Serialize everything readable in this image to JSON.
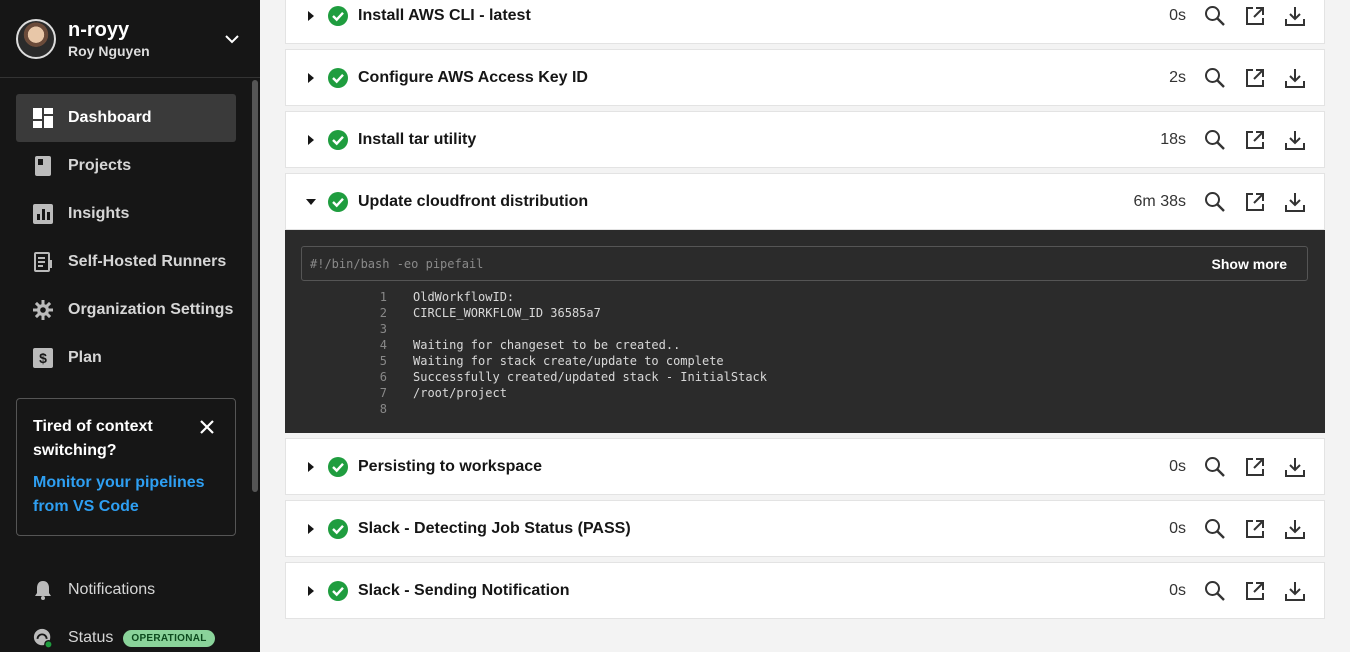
{
  "user": {
    "handle": "n-royy",
    "name": "Roy Nguyen"
  },
  "sidebar": {
    "items": [
      {
        "label": "Dashboard",
        "icon": "dashboard-icon",
        "active": true
      },
      {
        "label": "Projects",
        "icon": "projects-icon"
      },
      {
        "label": "Insights",
        "icon": "insights-icon"
      },
      {
        "label": "Self-Hosted Runners",
        "icon": "runners-icon"
      },
      {
        "label": "Organization Settings",
        "icon": "gear-icon"
      },
      {
        "label": "Plan",
        "icon": "plan-icon"
      }
    ],
    "promo": {
      "title": "Tired of context switching?",
      "link": "Monitor your pipelines from VS Code"
    },
    "notifications_label": "Notifications",
    "status_label": "Status",
    "status_badge": "OPERATIONAL"
  },
  "steps": [
    {
      "label": "Install AWS CLI - latest",
      "duration": "0s"
    },
    {
      "label": "Configure AWS Access Key ID",
      "duration": "2s"
    },
    {
      "label": "Install tar utility",
      "duration": "18s"
    },
    {
      "label": "Update cloudfront distribution",
      "duration": "6m 38s",
      "expanded": true
    },
    {
      "label": "Persisting to workspace",
      "duration": "0s"
    },
    {
      "label": "Slack - Detecting Job Status (PASS)",
      "duration": "0s"
    },
    {
      "label": "Slack - Sending Notification",
      "duration": "0s"
    }
  ],
  "terminal": {
    "command": "#!/bin/bash -eo pipefail",
    "show_more": "Show more",
    "lines": [
      {
        "n": "1",
        "text": "OldWorkflowID:"
      },
      {
        "n": "2",
        "text": "CIRCLE_WORKFLOW_ID 36585a7"
      },
      {
        "n": "3",
        "text": ""
      },
      {
        "n": "4",
        "text": "Waiting for changeset to be created.."
      },
      {
        "n": "5",
        "text": "Waiting for stack create/update to complete"
      },
      {
        "n": "6",
        "text": "Successfully created/updated stack - InitialStack"
      },
      {
        "n": "7",
        "text": "/root/project"
      },
      {
        "n": "8",
        "text": ""
      }
    ]
  },
  "colors": {
    "success": "#1f9d3f",
    "link": "#2e9ff2",
    "sidebar_bg": "#161616"
  }
}
